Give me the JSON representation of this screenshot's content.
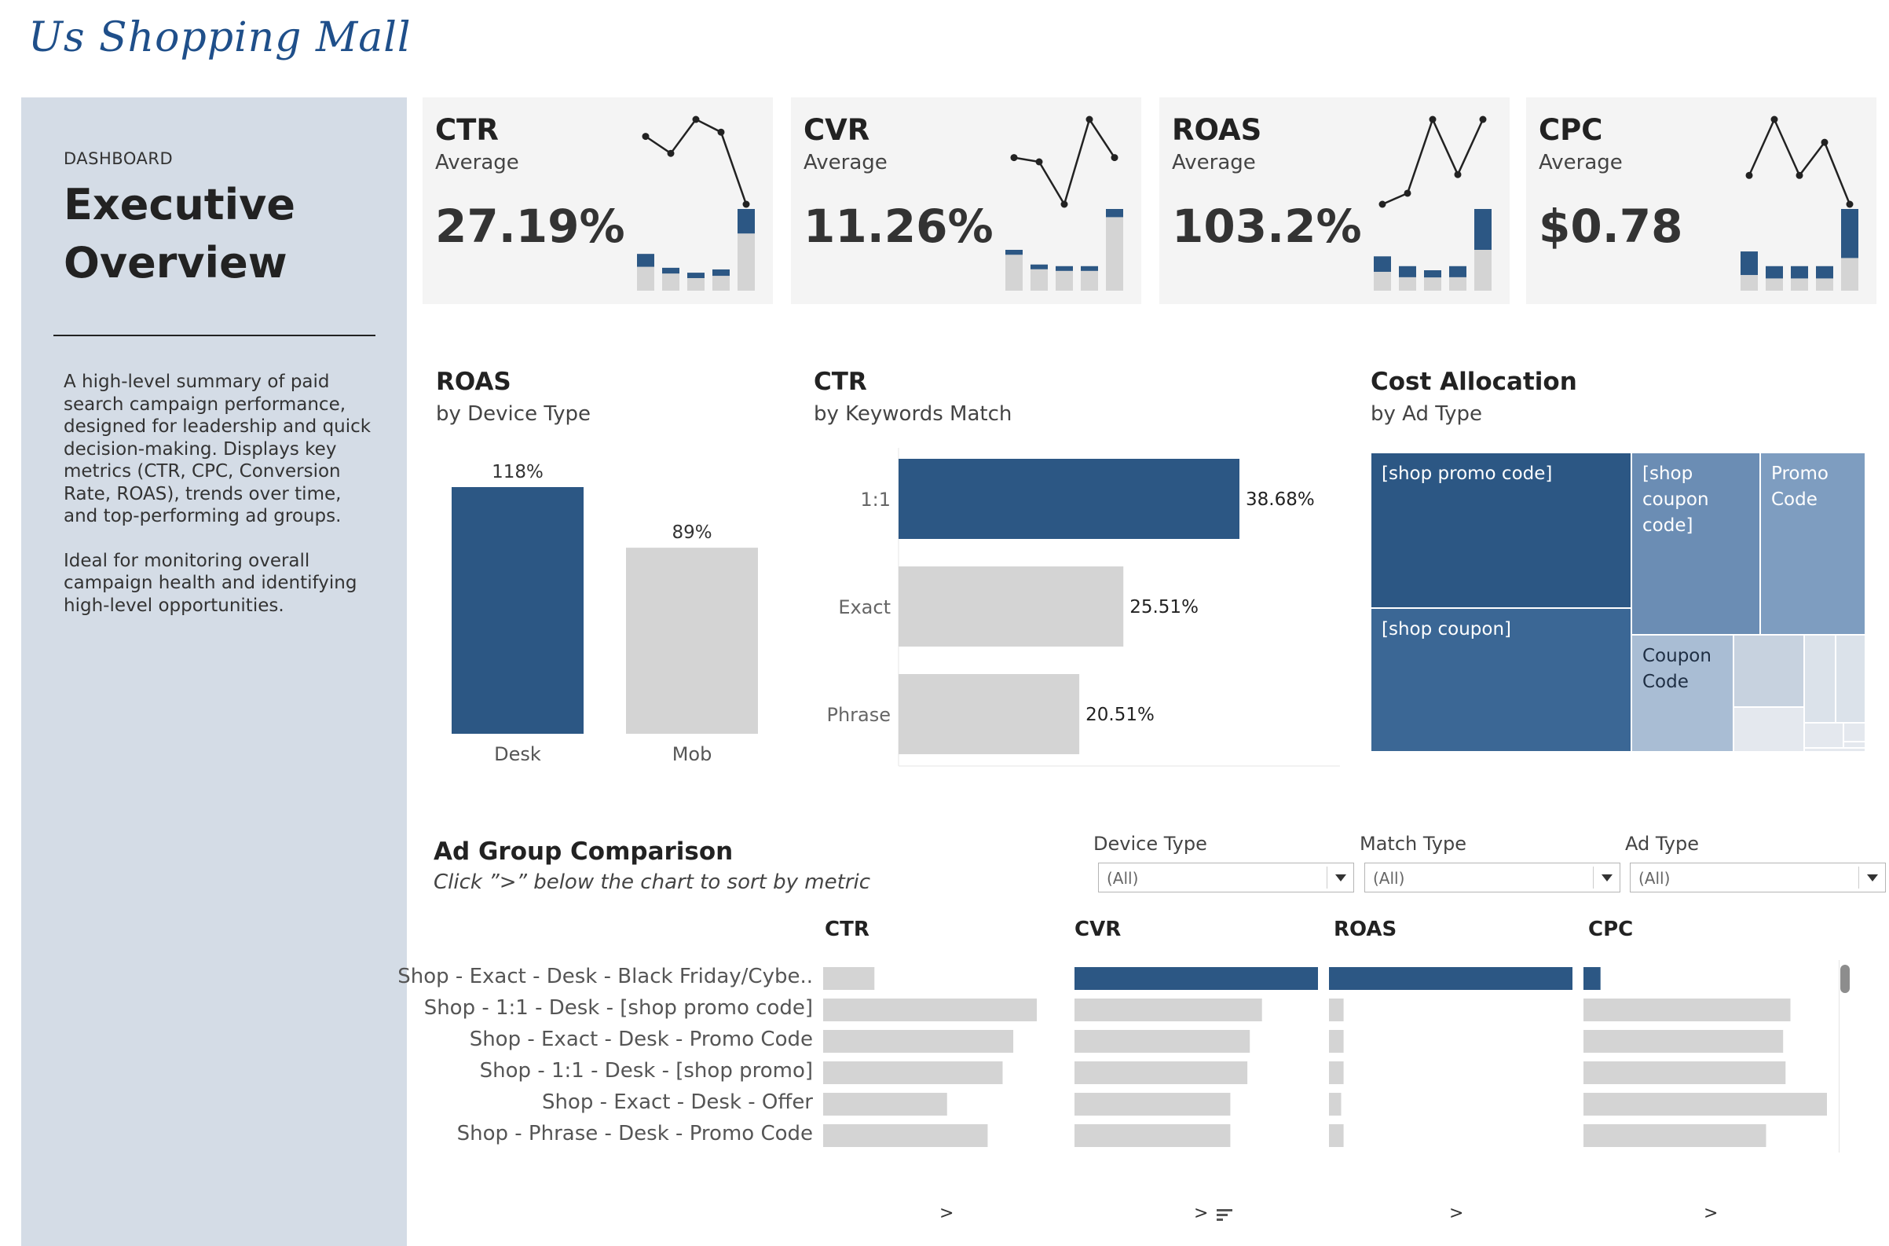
{
  "header": {
    "logo_text": "Us Shopping Mall"
  },
  "sidebar": {
    "kicker": "DASHBOARD",
    "title_line1": "Executive",
    "title_line2": "Overview",
    "description": "A high-level summary of paid search campaign performance, designed for leadership and quick decision-making. Displays key metrics (CTR, CPC, Conversion Rate, ROAS), trends over time, and top-performing ad groups.",
    "note": "Ideal for monitoring overall campaign health and identifying high-level opportunities."
  },
  "colors": {
    "accent": "#2c5784",
    "gray_bar": "#d4d4d4",
    "sidebar_bg": "#d4dce6",
    "card_bg": "#f4f4f4",
    "tree_shades": [
      "#2c5784",
      "#3b6795",
      "#6b8db4",
      "#7e9dc0",
      "#a9bdd4",
      "#c7d2df",
      "#dbe2ea",
      "#e4e8ee"
    ]
  },
  "kpis": [
    {
      "name": "CTR",
      "sub": "Average",
      "value": "27.19%",
      "line": [
        0.2,
        0.4,
        0.0,
        0.15,
        1.0
      ],
      "bars": [
        0.45,
        0.28,
        0.22,
        0.26,
        1.0
      ],
      "bars_blue": [
        0.35,
        0.25,
        0.3,
        0.3,
        0.3
      ]
    },
    {
      "name": "CVR",
      "sub": "Average",
      "value": "11.26%",
      "line": [
        0.45,
        0.5,
        1.0,
        0.0,
        0.45
      ],
      "bars": [
        0.5,
        0.32,
        0.3,
        0.3,
        1.0
      ],
      "bars_blue": [
        0.12,
        0.1,
        0.08,
        0.1,
        0.1
      ]
    },
    {
      "name": "ROAS",
      "sub": "Average",
      "value": "103.2%",
      "line": [
        1.0,
        0.87,
        0.0,
        0.65,
        0.0
      ],
      "bars": [
        0.42,
        0.3,
        0.25,
        0.3,
        1.0
      ],
      "bars_blue": [
        0.45,
        0.45,
        0.35,
        0.45,
        0.5
      ]
    },
    {
      "name": "CPC",
      "sub": "Average",
      "value": "$0.78",
      "line": [
        0.66,
        0.0,
        0.66,
        0.27,
        1.0
      ],
      "bars": [
        0.48,
        0.3,
        0.3,
        0.3,
        1.0
      ],
      "bars_blue": [
        0.6,
        0.5,
        0.5,
        0.5,
        0.6
      ]
    }
  ],
  "roas_device": {
    "title": "ROAS",
    "subtitle": "by Device Type",
    "chart_data": {
      "type": "bar",
      "categories": [
        "Desk",
        "Mob"
      ],
      "values": [
        118,
        89
      ],
      "labels": [
        "118%",
        "89%"
      ],
      "ylim": [
        0,
        118
      ],
      "colors": [
        "#2c5784",
        "#d4d4d4"
      ]
    }
  },
  "ctr_match": {
    "title": "CTR",
    "subtitle": "by Keywords Match",
    "chart_data": {
      "type": "bar",
      "orientation": "horizontal",
      "categories": [
        "1:1",
        "Exact",
        "Phrase"
      ],
      "values": [
        38.68,
        25.51,
        20.51
      ],
      "labels": [
        "38.68%",
        "25.51%",
        "20.51%"
      ],
      "xlim": [
        0,
        38.68
      ],
      "colors": [
        "#2c5784",
        "#d4d4d4",
        "#d4d4d4"
      ]
    }
  },
  "cost_allocation": {
    "title": "Cost Allocation",
    "subtitle": "by Ad Type",
    "chart_data": {
      "type": "treemap",
      "cells": [
        {
          "label": "[shop promo code]",
          "shade": 0
        },
        {
          "label": "[shop coupon]",
          "shade": 1
        },
        {
          "label": "[shop coupon code]",
          "shade": 2
        },
        {
          "label": "Promo Code",
          "shade": 3
        },
        {
          "label": "Coupon Code",
          "shade": 4
        },
        {
          "label": "",
          "shade": 5
        },
        {
          "label": "",
          "shade": 6
        },
        {
          "label": "",
          "shade": 6
        },
        {
          "label": "",
          "shade": 7
        },
        {
          "label": "",
          "shade": 7
        },
        {
          "label": "",
          "shade": 7
        },
        {
          "label": "",
          "shade": 7
        },
        {
          "label": "",
          "shade": 7
        }
      ]
    }
  },
  "ad_group": {
    "title": "Ad Group Comparison",
    "subtitle": "Click ”>” below the chart to sort by metric",
    "filters": [
      {
        "label": "Device Type",
        "value": "(All)"
      },
      {
        "label": "Match Type",
        "value": "(All)"
      },
      {
        "label": "Ad Type",
        "value": "(All)"
      }
    ],
    "sort_arrow": ">",
    "chart_data": {
      "type": "bar",
      "orientation": "horizontal",
      "categories": [
        "Shop - Exact - Desk - Black Friday/Cybe..",
        "Shop - 1:1 - Desk - [shop promo code]",
        "Shop - Exact - Desk - Promo Code",
        "Shop - 1:1 - Desk - [shop promo]",
        "Shop - Exact - Desk - Offer",
        "Shop - Phrase - Desk - Promo Code"
      ],
      "series": [
        {
          "name": "CTR",
          "values": [
            0.24,
            1.0,
            0.89,
            0.84,
            0.58,
            0.77
          ],
          "highlight": -1
        },
        {
          "name": "CVR",
          "values": [
            1.0,
            0.77,
            0.72,
            0.71,
            0.64,
            0.64
          ],
          "highlight": 0
        },
        {
          "name": "ROAS",
          "values": [
            1.0,
            0.06,
            0.06,
            0.06,
            0.05,
            0.06
          ],
          "highlight": 0
        },
        {
          "name": "CPC",
          "values": [
            0.07,
            0.85,
            0.82,
            0.83,
            1.0,
            0.75
          ],
          "highlight": 0
        }
      ]
    }
  }
}
